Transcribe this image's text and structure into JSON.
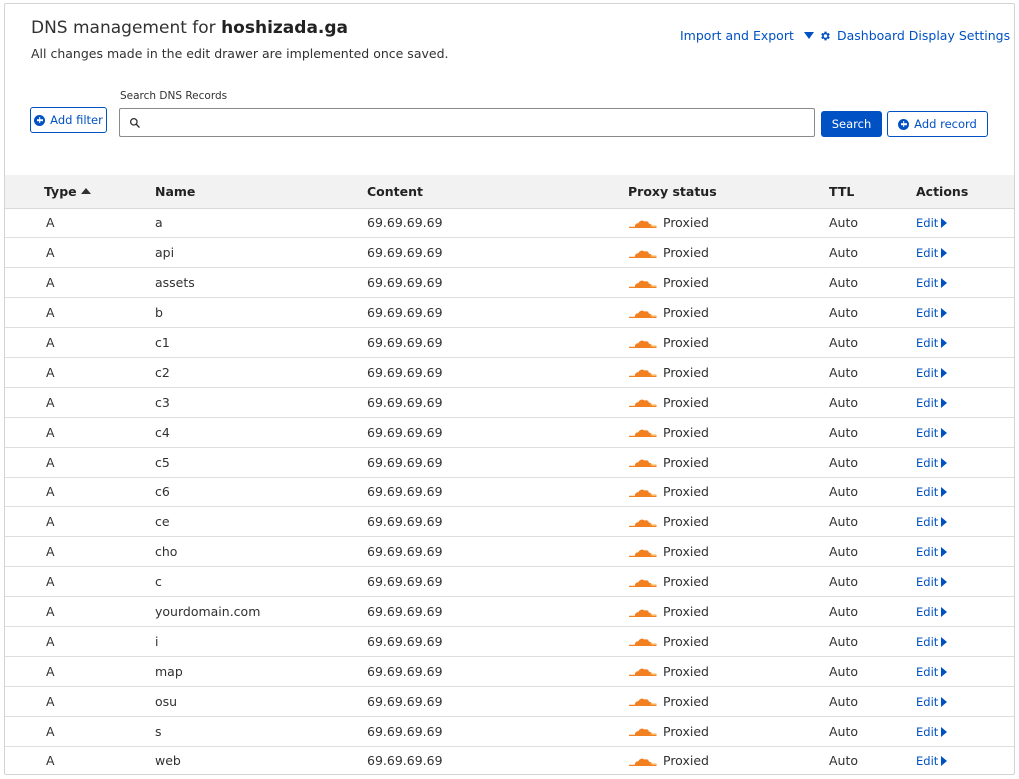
{
  "header": {
    "title_prefix": "DNS management for ",
    "domain": "hoshizada.ga",
    "subtitle": "All changes made in the edit drawer are implemented once saved.",
    "import_export_label": "Import and Export",
    "dashboard_settings_label": "Dashboard Display Settings"
  },
  "toolbar": {
    "add_filter_label": "Add filter",
    "search_label": "Search DNS Records",
    "search_value": "",
    "search_placeholder": "",
    "search_button_label": "Search",
    "add_record_label": "Add record"
  },
  "table": {
    "columns": {
      "type": "Type",
      "name": "Name",
      "content": "Content",
      "proxy": "Proxy status",
      "ttl": "TTL",
      "actions": "Actions"
    },
    "sort": {
      "column": "Type",
      "direction": "ascending"
    },
    "edit_label": "Edit",
    "rows": [
      {
        "type": "A",
        "name": "a",
        "content": "69.69.69.69",
        "proxy": "Proxied",
        "ttl": "Auto"
      },
      {
        "type": "A",
        "name": "api",
        "content": "69.69.69.69",
        "proxy": "Proxied",
        "ttl": "Auto"
      },
      {
        "type": "A",
        "name": "assets",
        "content": "69.69.69.69",
        "proxy": "Proxied",
        "ttl": "Auto"
      },
      {
        "type": "A",
        "name": "b",
        "content": "69.69.69.69",
        "proxy": "Proxied",
        "ttl": "Auto"
      },
      {
        "type": "A",
        "name": "c1",
        "content": "69.69.69.69",
        "proxy": "Proxied",
        "ttl": "Auto"
      },
      {
        "type": "A",
        "name": "c2",
        "content": "69.69.69.69",
        "proxy": "Proxied",
        "ttl": "Auto"
      },
      {
        "type": "A",
        "name": "c3",
        "content": "69.69.69.69",
        "proxy": "Proxied",
        "ttl": "Auto"
      },
      {
        "type": "A",
        "name": "c4",
        "content": "69.69.69.69",
        "proxy": "Proxied",
        "ttl": "Auto"
      },
      {
        "type": "A",
        "name": "c5",
        "content": "69.69.69.69",
        "proxy": "Proxied",
        "ttl": "Auto"
      },
      {
        "type": "A",
        "name": "c6",
        "content": "69.69.69.69",
        "proxy": "Proxied",
        "ttl": "Auto"
      },
      {
        "type": "A",
        "name": "ce",
        "content": "69.69.69.69",
        "proxy": "Proxied",
        "ttl": "Auto"
      },
      {
        "type": "A",
        "name": "cho",
        "content": "69.69.69.69",
        "proxy": "Proxied",
        "ttl": "Auto"
      },
      {
        "type": "A",
        "name": "c",
        "content": "69.69.69.69",
        "proxy": "Proxied",
        "ttl": "Auto"
      },
      {
        "type": "A",
        "name": "yourdomain.com",
        "content": "69.69.69.69",
        "proxy": "Proxied",
        "ttl": "Auto"
      },
      {
        "type": "A",
        "name": "i",
        "content": "69.69.69.69",
        "proxy": "Proxied",
        "ttl": "Auto"
      },
      {
        "type": "A",
        "name": "map",
        "content": "69.69.69.69",
        "proxy": "Proxied",
        "ttl": "Auto"
      },
      {
        "type": "A",
        "name": "osu",
        "content": "69.69.69.69",
        "proxy": "Proxied",
        "ttl": "Auto"
      },
      {
        "type": "A",
        "name": "s",
        "content": "69.69.69.69",
        "proxy": "Proxied",
        "ttl": "Auto"
      },
      {
        "type": "A",
        "name": "web",
        "content": "69.69.69.69",
        "proxy": "Proxied",
        "ttl": "Auto"
      }
    ]
  },
  "icons": {
    "proxy": "orange-cloud-icon",
    "settings": "gear-icon",
    "search": "search-icon",
    "add": "plus-circle-icon"
  },
  "colors": {
    "accent": "#0051c3",
    "proxied_cloud": "#f38020",
    "header_row": "#f2f2f2"
  }
}
